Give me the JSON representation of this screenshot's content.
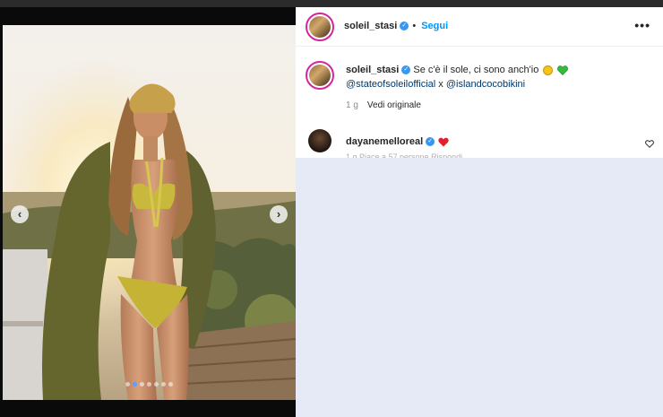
{
  "post": {
    "username": "soleil_stasi",
    "follow_label": "Segui",
    "separator": "•",
    "more_label": "•••"
  },
  "caption": {
    "username": "soleil_stasi",
    "text": "Se c'è il sole, ci sono anch'io",
    "mention1": "@stateofsoleilofficial",
    "join": " x ",
    "mention2": "@islandcocobikini",
    "time": "1 g",
    "see_original": "Vedi originale"
  },
  "comment": {
    "username": "dayanemelloreal",
    "cut_text": "1 g   Piace a 57 persone   Rispondi"
  },
  "carousel": {
    "prev": "‹",
    "next": "›",
    "dot_count": 7,
    "active_index": 1
  },
  "colors": {
    "accent": "#0095f6",
    "verified": "#3897f0",
    "lower_panel": "#e6e9f6"
  }
}
